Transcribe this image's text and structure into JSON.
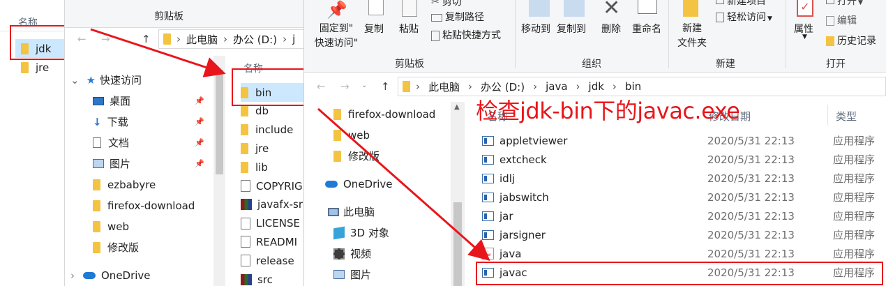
{
  "win1": {
    "header": "名称",
    "items": [
      "jdk",
      "jre"
    ]
  },
  "win2": {
    "ribbon_group": "剪贴板",
    "breadcrumb": [
      "此电脑",
      "办公 (D:)",
      "j"
    ],
    "nav": {
      "quick_access": "快速访问",
      "items": [
        {
          "label": "桌面",
          "icon": "desktop-icon"
        },
        {
          "label": "下载",
          "icon": "download-icon"
        },
        {
          "label": "文档",
          "icon": "document-icon"
        },
        {
          "label": "图片",
          "icon": "pictures-icon"
        },
        {
          "label": "ezbabyre",
          "icon": "folder-icon"
        },
        {
          "label": "firefox-download",
          "icon": "folder-icon"
        },
        {
          "label": "web",
          "icon": "folder-icon"
        },
        {
          "label": "修改版",
          "icon": "folder-icon"
        }
      ],
      "onedrive": "OneDrive"
    },
    "list_header": "名称",
    "files": [
      {
        "label": "bin",
        "icon": "folder"
      },
      {
        "label": "db",
        "icon": "folder"
      },
      {
        "label": "include",
        "icon": "folder"
      },
      {
        "label": "jre",
        "icon": "folder"
      },
      {
        "label": "lib",
        "icon": "folder"
      },
      {
        "label": "COPYRIG",
        "icon": "doc"
      },
      {
        "label": "javafx-sr",
        "icon": "rar"
      },
      {
        "label": "LICENSE",
        "icon": "doc"
      },
      {
        "label": "READMI",
        "icon": "doc"
      },
      {
        "label": "release",
        "icon": "doc"
      },
      {
        "label": "src",
        "icon": "rar"
      }
    ]
  },
  "win3": {
    "ribbon": {
      "pin_label_1": "固定到\"",
      "pin_label_2": "快速访问\"",
      "copy": "复制",
      "paste": "粘贴",
      "cut": "剪切",
      "copy_path": "复制路径",
      "paste_shortcut": "粘贴快捷方式",
      "move_to": "移动到",
      "copy_to": "复制到",
      "delete": "删除",
      "rename": "重命名",
      "new_folder_1": "新建",
      "new_folder_2": "文件夹",
      "new_item": "新建项目",
      "easy_access": "轻松访问",
      "properties": "属性",
      "open": "打开",
      "edit": "编辑",
      "history": "历史记录",
      "groups": [
        "剪贴板",
        "组织",
        "新建",
        "打开"
      ]
    },
    "breadcrumb": [
      "此电脑",
      "办公 (D:)",
      "java",
      "jdk",
      "bin"
    ],
    "nav": {
      "items": [
        "firefox-download",
        "web",
        "修改版"
      ],
      "onedrive": "OneDrive",
      "this_pc": "此电脑",
      "pc_items": [
        {
          "label": "3D 对象",
          "icon": "3d-objects-icon"
        },
        {
          "label": "视频",
          "icon": "video-icon"
        },
        {
          "label": "图片",
          "icon": "pictures-icon"
        }
      ]
    },
    "columns": {
      "name": "名称",
      "date": "修改日期",
      "type": "类型"
    },
    "files": [
      {
        "name": "appletviewer",
        "date": "2020/5/31 22:13",
        "type": "应用程序"
      },
      {
        "name": "extcheck",
        "date": "2020/5/31 22:13",
        "type": "应用程序"
      },
      {
        "name": "idlj",
        "date": "2020/5/31 22:13",
        "type": "应用程序"
      },
      {
        "name": "jabswitch",
        "date": "2020/5/31 22:13",
        "type": "应用程序"
      },
      {
        "name": "jar",
        "date": "2020/5/31 22:13",
        "type": "应用程序"
      },
      {
        "name": "jarsigner",
        "date": "2020/5/31 22:13",
        "type": "应用程序"
      },
      {
        "name": "java",
        "date": "2020/5/31 22:13",
        "type": "应用程序"
      },
      {
        "name": "javac",
        "date": "2020/5/31 22:13",
        "type": "应用程序"
      }
    ]
  },
  "annotation": "检查jdk-bin下的javac.exe",
  "colors": {
    "annotation_red": "#e8161b",
    "selection": "#cce8ff",
    "folder": "#f4c342"
  }
}
